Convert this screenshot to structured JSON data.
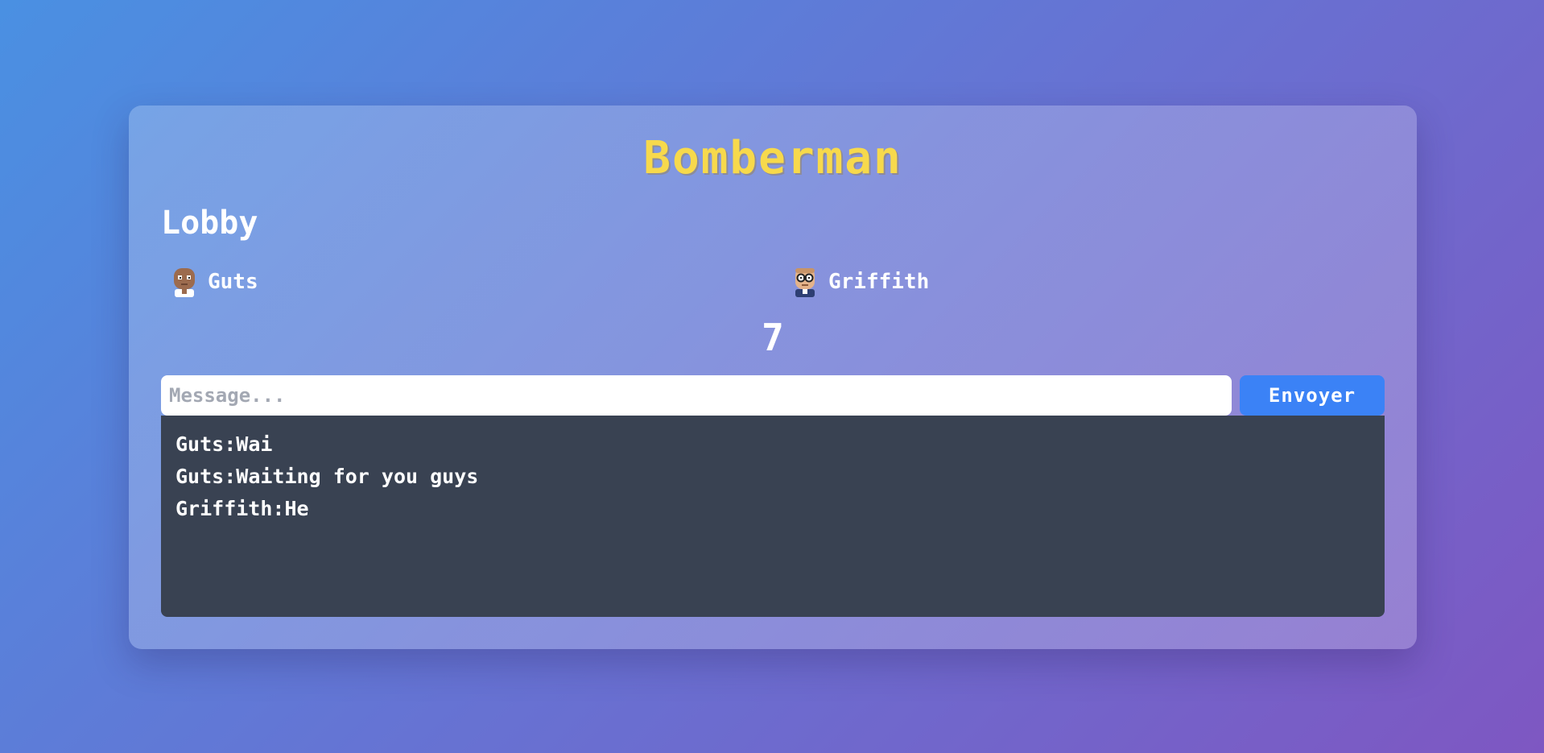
{
  "game": {
    "title": "Bomberman"
  },
  "lobby": {
    "title": "Lobby",
    "countdown": "7",
    "players": [
      {
        "name": "Guts",
        "avatar": "bald-man-avatar-icon"
      },
      {
        "name": "Griffith",
        "avatar": "glasses-man-avatar-icon"
      }
    ]
  },
  "chat": {
    "placeholder": "Message...",
    "value": "",
    "send_label": "Envoyer",
    "messages": [
      {
        "author": "Guts",
        "text": "Wai"
      },
      {
        "author": "Guts",
        "text": "Waiting for you guys"
      },
      {
        "author": "Griffith",
        "text": "He"
      }
    ]
  },
  "colors": {
    "title": "#f7d94c",
    "send_button": "#3b82f6",
    "chat_background": "#394252"
  }
}
